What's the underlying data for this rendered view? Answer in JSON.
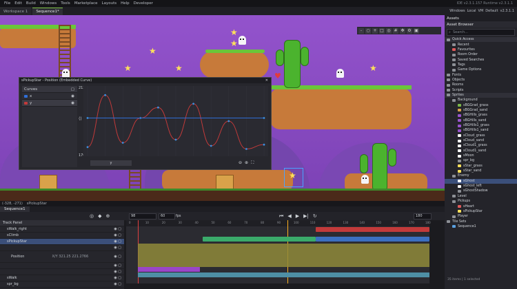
{
  "menu": [
    "File",
    "Edit",
    "Build",
    "Windows",
    "Tools",
    "Marketplace",
    "Layouts",
    "Help",
    "Developer"
  ],
  "version_text": "IDE v2.3.1.157  Runtime v2.3.1.1",
  "tabs": [
    {
      "label": "Workspace 1"
    },
    {
      "label": "Sequence1*"
    }
  ],
  "top_right": {
    "windows": "Windows",
    "local": "Local",
    "vm": "VM",
    "default": "Default",
    "target": "v2.3.1.1"
  },
  "scene_tools": [
    "zoom-out",
    "zoom-reset",
    "zoom-in",
    "zoom-fit",
    "zoom-sel",
    "grid",
    "move",
    "settings"
  ],
  "status": {
    "coords": "(-328, -271)",
    "object": "sPickupStar"
  },
  "curve_window": {
    "title": "sPickupStar - Position (Embedded Curve)",
    "panel_header": "Curves",
    "curves": [
      {
        "name": "x",
        "color": "#2f6fd8"
      },
      {
        "name": "y",
        "color": "#c23a3a"
      }
    ],
    "y_max": "212",
    "y_min": "170.5",
    "x_button": "y"
  },
  "chart_data": {
    "type": "line",
    "series": [
      {
        "name": "y",
        "color": "#c23a3a",
        "points": [
          [
            0,
            0.08
          ],
          [
            0.1,
            0.92
          ],
          [
            0.2,
            0.15
          ],
          [
            0.3,
            0.55
          ],
          [
            0.4,
            0.72
          ],
          [
            0.5,
            0.2
          ],
          [
            0.6,
            0.78
          ],
          [
            0.7,
            0.1
          ],
          [
            0.8,
            0.5
          ],
          [
            0.9,
            0.05
          ],
          [
            1,
            0.12
          ]
        ]
      },
      {
        "name": "x",
        "color": "#2f6fd8",
        "points": [
          [
            0,
            0.55
          ],
          [
            1,
            0.55
          ]
        ]
      }
    ]
  },
  "asset_browser": {
    "title": "Assets",
    "header": "Asset Browser",
    "search_placeholder": "Search...",
    "items": [
      {
        "label": "Quick Access",
        "level": 0,
        "hdr": true,
        "color": "#8d9096"
      },
      {
        "label": "Recent",
        "level": 1,
        "color": "#8d9096"
      },
      {
        "label": "Favourites",
        "level": 1,
        "color": "#e05a5a"
      },
      {
        "label": "Room Order",
        "level": 1,
        "color": "#8d9096"
      },
      {
        "label": "Saved Searches",
        "level": 1,
        "color": "#8d9096"
      },
      {
        "label": "Tags",
        "level": 1,
        "color": "#8d9096"
      },
      {
        "label": "Game Options",
        "level": 1,
        "color": "#8d9096"
      },
      {
        "label": "Fonts",
        "level": 0,
        "color": "#8d9096"
      },
      {
        "label": "Objects",
        "level": 0,
        "color": "#8d9096"
      },
      {
        "label": "Rooms",
        "level": 0,
        "color": "#8d9096"
      },
      {
        "label": "Scripts",
        "level": 0,
        "color": "#8d9096"
      },
      {
        "label": "Sprites",
        "level": 0,
        "hdr": true,
        "color": "#8d9096"
      },
      {
        "label": "Background",
        "level": 1,
        "color": "#8d9096"
      },
      {
        "label": "sBGGrad_grass",
        "level": 2,
        "color": "#7ab648"
      },
      {
        "label": "sBGGrad_sand",
        "level": 2,
        "color": "#d9a24a"
      },
      {
        "label": "sBGHills_grass",
        "level": 2,
        "color": "#9a55d0"
      },
      {
        "label": "sBGHills_sand",
        "level": 2,
        "color": "#9a55d0"
      },
      {
        "label": "sBGHills1_grass",
        "level": 2,
        "color": "#9a55d0"
      },
      {
        "label": "sBGHills1_sand",
        "level": 2,
        "color": "#9a55d0"
      },
      {
        "label": "sCloud_grass",
        "level": 2,
        "color": "#ffffff"
      },
      {
        "label": "sCloud_sand",
        "level": 2,
        "color": "#ffffff"
      },
      {
        "label": "sCloud1_grass",
        "level": 2,
        "color": "#ffffff"
      },
      {
        "label": "sCloud1_sand",
        "level": 2,
        "color": "#ffffff"
      },
      {
        "label": "sMoon",
        "level": 2,
        "color": "#ffffff"
      },
      {
        "label": "spr_bg",
        "level": 2,
        "color": "#8d9096"
      },
      {
        "label": "sStar_grass",
        "level": 2,
        "color": "#ffe15a"
      },
      {
        "label": "sStar_sand",
        "level": 2,
        "color": "#ffe15a"
      },
      {
        "label": "Enemy",
        "level": 1,
        "color": "#8d9096"
      },
      {
        "label": "sGhost",
        "level": 2,
        "sel": true,
        "color": "#ffffff"
      },
      {
        "label": "sGhost_left",
        "level": 2,
        "color": "#ffffff"
      },
      {
        "label": "sGhostShadow",
        "level": 2,
        "color": "#8d9096"
      },
      {
        "label": "Level",
        "level": 1,
        "color": "#8d9096"
      },
      {
        "label": "Pickups",
        "level": 1,
        "color": "#8d9096"
      },
      {
        "label": "sHeart",
        "level": 2,
        "color": "#e05a5a"
      },
      {
        "label": "sPickupStar",
        "level": 2,
        "color": "#ffe15a"
      },
      {
        "label": "Player",
        "level": 1,
        "color": "#8d9096"
      },
      {
        "label": "Tile Sets",
        "level": 0,
        "color": "#8d9096"
      },
      {
        "label": "Sequence1",
        "level": 1,
        "color": "#5aa0e0"
      }
    ],
    "footer": "35 items | 1 selected"
  },
  "sequence": {
    "tab": "Sequence1",
    "frame_value": "98",
    "length": "60",
    "fps_label": "fps",
    "end_frame": "180",
    "track_header": "Track Panel",
    "tracks": [
      {
        "label": "sWalk_right",
        "indent": 1
      },
      {
        "label": "sClimb",
        "indent": 1
      },
      {
        "label": "sPickupStar",
        "indent": 1,
        "sel": true
      },
      {
        "label": "",
        "indent": 2
      },
      {
        "label": "Position",
        "indent": 2,
        "value": "X/Y 321.25  221.2766"
      },
      {
        "label": "",
        "indent": 2
      },
      {
        "label": "",
        "indent": 2
      },
      {
        "label": "sWalk",
        "indent": 1
      },
      {
        "label": "spr_bg",
        "indent": 1
      }
    ],
    "ruler_ticks": [
      "0",
      "10",
      "20",
      "30",
      "40",
      "50",
      "60",
      "70",
      "80",
      "90",
      "100",
      "110",
      "120",
      "130",
      "140",
      "150",
      "160",
      "170",
      "180"
    ]
  }
}
